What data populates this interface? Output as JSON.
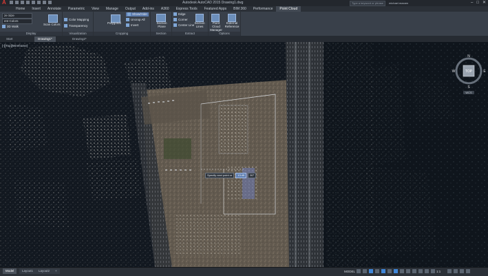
{
  "app": {
    "logo": "A",
    "doc_title": "Autodesk AutoCAD 2015  Drawing1.dwg",
    "search_placeholder": "Type a keyword or phrase",
    "user": "michael.maxam",
    "window_controls": [
      "–",
      "□",
      "✕"
    ]
  },
  "ribbon_tabs": [
    "Home",
    "Insert",
    "Annotate",
    "Parametric",
    "View",
    "Manage",
    "Output",
    "Add-ins",
    "A360",
    "Express Tools",
    "Featured Apps",
    "BIM 360",
    "Performance",
    "Point Cloud"
  ],
  "active_tab": "Point Cloud",
  "panels": {
    "display": {
      "label": "Display",
      "size_field": "ze Size",
      "color_field": "ent Colors",
      "walk": "3D Walk",
      "scan_colors": "Scan Colors"
    },
    "visualization": {
      "label": "Visualization",
      "color_mapping": "Color Mapping",
      "transparency": "Transparency"
    },
    "cropping": {
      "label": "Cropping",
      "polygonal": "Polygonal",
      "show_hide": "Show/Hide",
      "uncrop_all": "Uncrop All",
      "invert": "Invert"
    },
    "section": {
      "label": "Section",
      "section_plane": "Section Plane"
    },
    "extract": {
      "label": "Extract",
      "edge": "Edge",
      "corner": "Corner",
      "center_line": "Center Line",
      "section_lines": "Section Lines"
    },
    "options": {
      "label": "Options",
      "manager": "Point Cloud Manager",
      "external": "External Reference"
    }
  },
  "doc_tabs": [
    "Start",
    "Drawing1*",
    "Drawing2*"
  ],
  "active_doc_tab": "Drawing1*",
  "viewport": {
    "label": "[-][Top][Wireframe]",
    "tooltip": {
      "prompt": "Specify next point or",
      "value_a": "13.45",
      "value_b": "90°"
    },
    "viewcube": {
      "n": "N",
      "s": "S",
      "e": "E",
      "w": "W",
      "face": "TOP",
      "wcs": "WCS"
    }
  },
  "status": {
    "layout_tabs": [
      "Model",
      "Layout1",
      "Layout2"
    ],
    "active_layout": "Model",
    "add_tab": "+",
    "model": "MODEL",
    "scale": "1:1"
  }
}
